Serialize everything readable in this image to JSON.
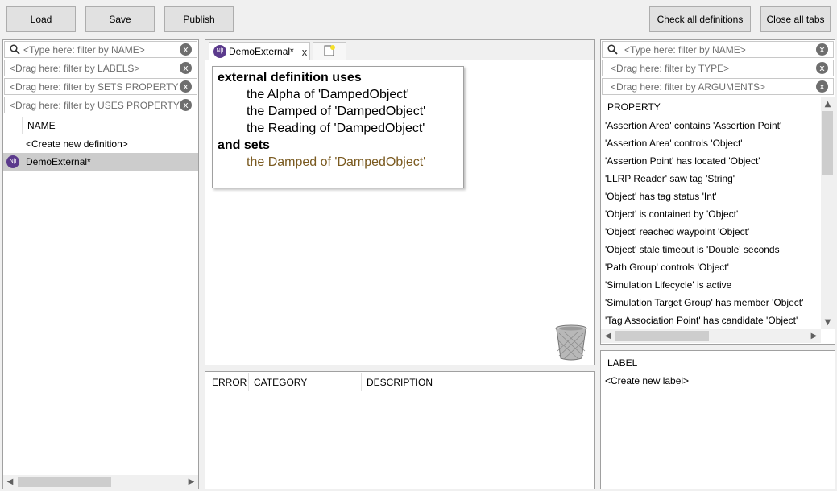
{
  "toolbar": {
    "load": "Load",
    "save": "Save",
    "publish": "Publish",
    "check_all": "Check all definitions",
    "close_all": "Close all tabs"
  },
  "left": {
    "filters": [
      "<Type here: filter by NAME>",
      "<Drag here: filter by LABELS>",
      "<Drag here: filter by SETS PROPERTY>",
      "<Drag here: filter by USES PROPERTY>"
    ],
    "header": "NAME",
    "create_new": "<Create new definition>",
    "items": [
      {
        "label": "DemoExternal*",
        "badge": "N|I"
      }
    ]
  },
  "center": {
    "tabs": [
      {
        "label": "DemoExternal*",
        "badge": "N|I",
        "close": "x"
      }
    ],
    "editor": {
      "line1": "external definition uses",
      "uses": [
        "the Alpha of 'DampedObject'",
        "the Damped of 'DampedObject'",
        "the Reading of 'DampedObject'"
      ],
      "line_sets": "and sets",
      "sets": [
        "the Damped of 'DampedObject'"
      ]
    },
    "errors_columns": [
      "ERROR",
      "CATEGORY",
      "DESCRIPTION"
    ]
  },
  "right": {
    "filters": [
      "<Type here: filter by NAME>",
      "<Drag here: filter by TYPE>",
      "<Drag here: filter by ARGUMENTS>"
    ],
    "property_header": "PROPERTY",
    "properties": [
      "'Assertion Area' contains 'Assertion Point'",
      "'Assertion Area' controls 'Object'",
      "'Assertion Point' has located 'Object'",
      "'LLRP Reader' saw tag 'String'",
      "'Object' has tag status 'Int'",
      "'Object' is contained by 'Object'",
      "'Object' reached waypoint 'Object'",
      "'Object' stale timeout is 'Double' seconds",
      "'Path Group' controls 'Object'",
      "'Simulation Lifecycle' is active",
      "'Simulation Target Group' has member 'Object'",
      "'Tag Association Point' has candidate 'Object'"
    ],
    "label_header": "LABEL",
    "create_label": "<Create new label>"
  },
  "icons": {
    "clear": "x",
    "left_arrow": "◀",
    "right_arrow": "▶",
    "up_arrow": "▲",
    "down_arrow": "▼"
  },
  "colors": {
    "selection": "#cccccc",
    "badge": "#5b3a8c",
    "sets_text": "#7a5a20"
  }
}
